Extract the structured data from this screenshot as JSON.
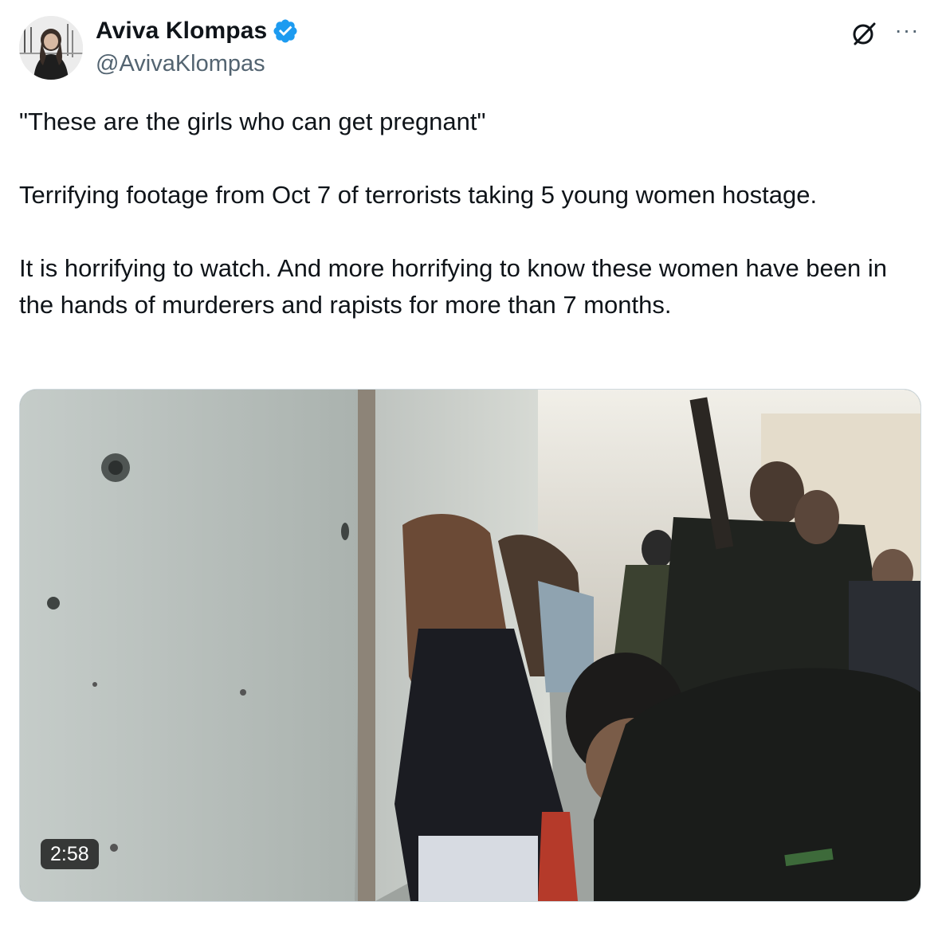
{
  "author": {
    "display_name": "Aviva Klompas",
    "handle": "@AvivaKlompas",
    "verified": true,
    "avatar": "avatar-photo"
  },
  "header": {
    "grok_icon": "grok-icon",
    "more_label": "···"
  },
  "tweet": {
    "paragraphs": [
      "\"These are the girls who can get pregnant\"",
      "Terrifying footage from Oct 7 of terrorists taking 5 young women hostage.",
      "It is horrifying to watch. And more horrifying to know these women have been in the hands of murderers and rapists for more than 7 months."
    ]
  },
  "media": {
    "type": "video",
    "duration": "2:58"
  },
  "colors": {
    "text": "#0f1419",
    "secondary": "#536471",
    "verified": "#1d9bf0",
    "border": "#cfd9de"
  }
}
